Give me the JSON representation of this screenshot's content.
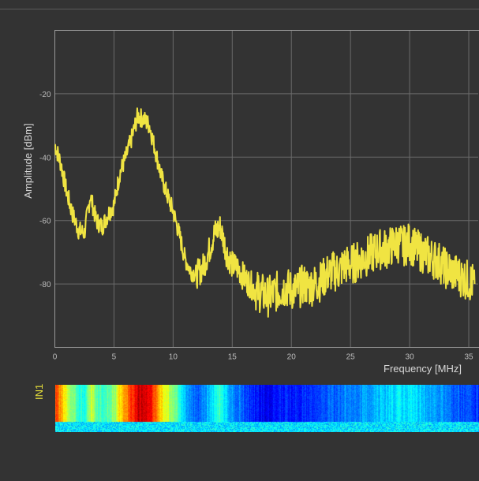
{
  "colors": {
    "background": "#333333",
    "grid": "#6b6b6b",
    "trace": "#f0e442",
    "label_accent": "#e9e23a"
  },
  "waterfall": {
    "channel_label": "IN1",
    "colormap": "jet"
  },
  "chart_data": {
    "type": "line",
    "title": "",
    "xlabel": "Frequency [MHz]",
    "ylabel": "Amplitude [dBm]",
    "xlim": [
      0,
      35.8
    ],
    "ylim": [
      -100,
      0
    ],
    "x_ticks": [
      0,
      5,
      10,
      15,
      20,
      25,
      30,
      35
    ],
    "y_ticks": [
      -20,
      -40,
      -60,
      -80
    ],
    "grid": true,
    "series": [
      {
        "color": "#f0e442",
        "x": [
          0,
          0.5,
          1,
          1.5,
          2,
          2.5,
          3,
          3.5,
          4,
          4.5,
          5,
          5.5,
          6,
          6.5,
          7,
          7.5,
          8,
          8.5,
          9,
          9.5,
          10,
          10.5,
          11,
          11.5,
          12,
          12.5,
          13,
          13.5,
          14,
          14.5,
          15,
          15.5,
          16,
          16.5,
          17,
          17.5,
          18,
          18.5,
          19,
          19.5,
          20,
          20.5,
          21,
          21.5,
          22,
          22.5,
          23,
          23.5,
          24,
          24.5,
          25,
          25.5,
          26,
          26.5,
          27,
          27.5,
          28,
          28.5,
          29,
          29.5,
          30,
          30.5,
          31,
          31.5,
          32,
          32.5,
          33,
          33.5,
          34,
          34.5,
          35,
          35.5
        ],
        "y": [
          -36,
          -42,
          -51,
          -58,
          -63,
          -64,
          -52,
          -60,
          -62,
          -58,
          -55,
          -45,
          -40,
          -34,
          -27,
          -28,
          -30,
          -38,
          -46,
          -52,
          -57,
          -64,
          -72,
          -76,
          -77,
          -75,
          -70,
          -64,
          -62,
          -70,
          -74,
          -75,
          -78,
          -80,
          -82,
          -83,
          -84,
          -83,
          -82,
          -81,
          -82,
          -82,
          -80,
          -81,
          -80,
          -79,
          -77,
          -76,
          -76,
          -74,
          -74,
          -73,
          -72,
          -71,
          -70,
          -69,
          -69,
          -68,
          -67,
          -68,
          -67,
          -69,
          -70,
          -71,
          -72,
          -73,
          -75,
          -76,
          -77,
          -78,
          -79,
          -80
        ]
      }
    ]
  }
}
